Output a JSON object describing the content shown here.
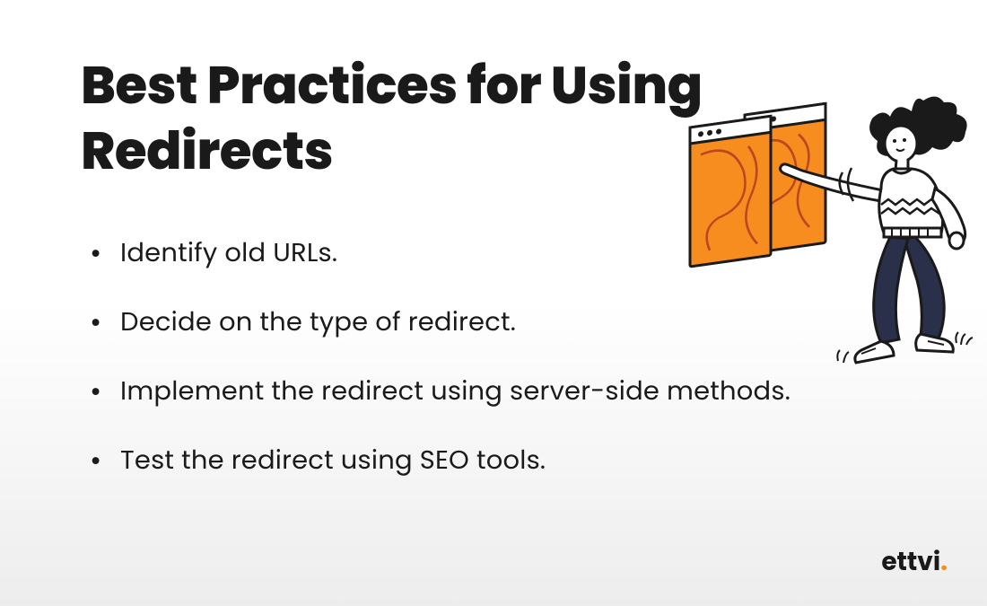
{
  "heading": "Best Practices for Using Redirects",
  "bullets": [
    "Identify old URLs.",
    "Decide on the type of redirect.",
    "Implement the redirect using server-side methods.",
    "Test the redirect using SEO tools."
  ],
  "logo": {
    "text": "ettvi",
    "dot": "."
  },
  "colors": {
    "accent": "#f78c1f",
    "text": "#1a1a1a"
  }
}
